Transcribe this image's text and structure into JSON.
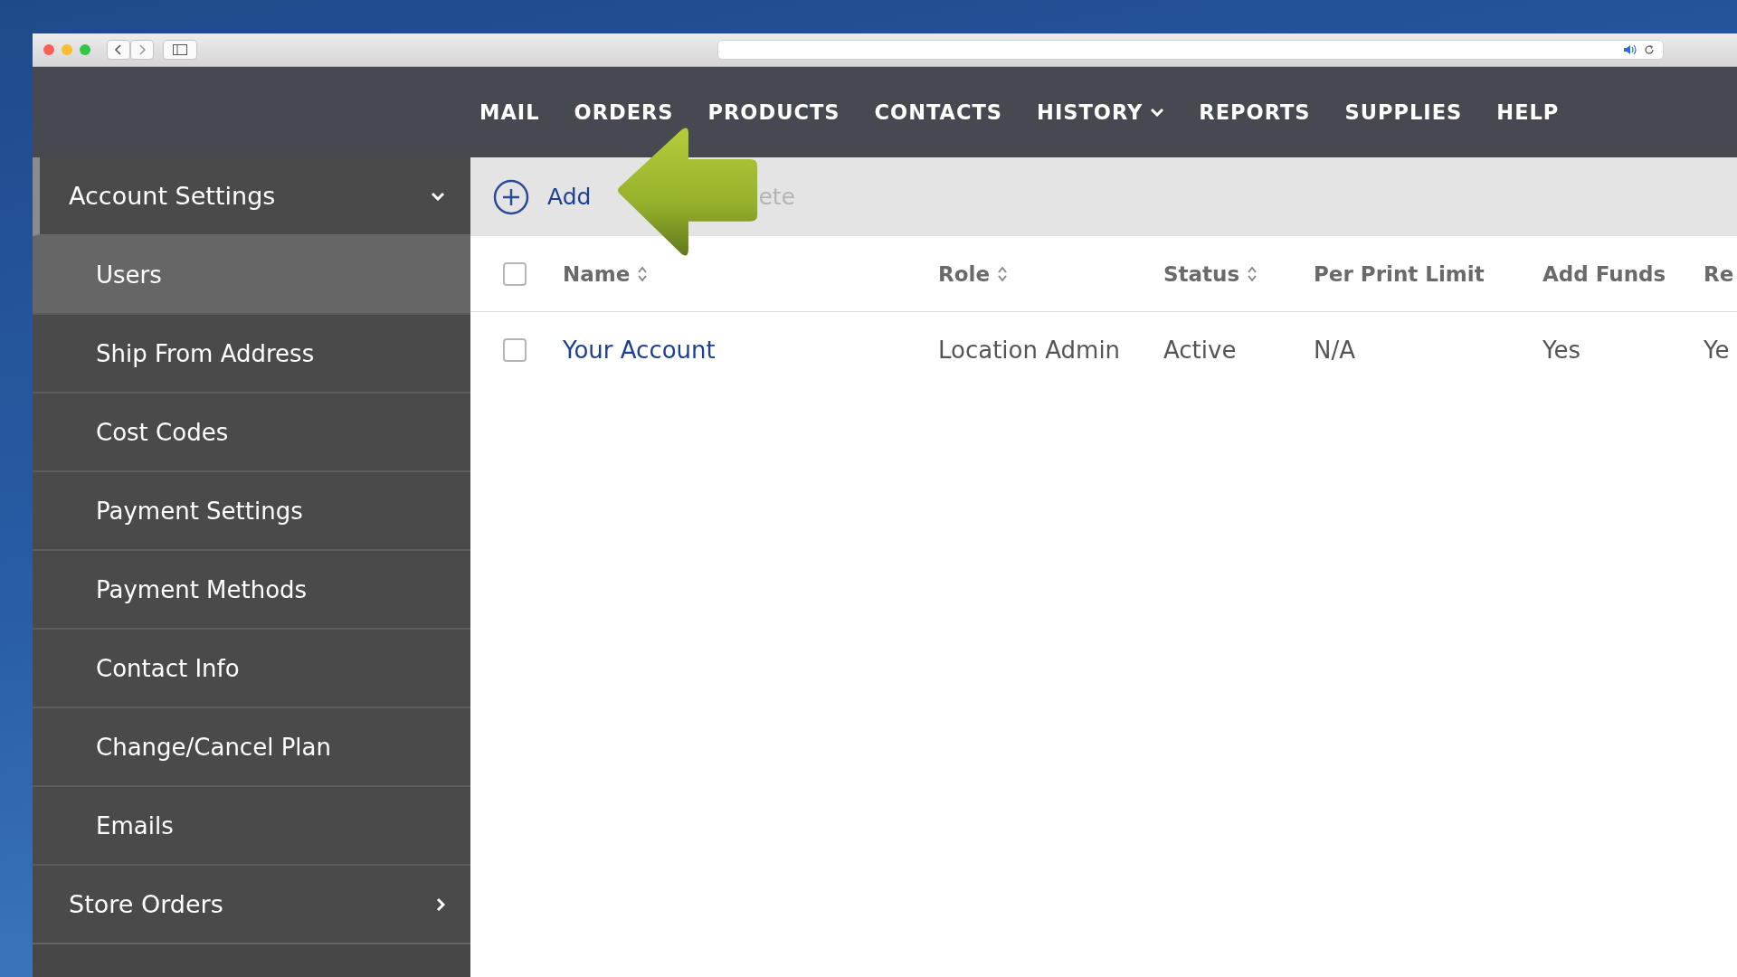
{
  "nav": [
    {
      "label": "MAIL",
      "has_menu": false
    },
    {
      "label": "ORDERS",
      "has_menu": false
    },
    {
      "label": "PRODUCTS",
      "has_menu": false
    },
    {
      "label": "CONTACTS",
      "has_menu": false
    },
    {
      "label": "HISTORY",
      "has_menu": true
    },
    {
      "label": "REPORTS",
      "has_menu": false
    },
    {
      "label": "SUPPLIES",
      "has_menu": false
    },
    {
      "label": "HELP",
      "has_menu": false
    }
  ],
  "sidebar": [
    {
      "label": "Account Settings",
      "expanded": true,
      "children": [
        {
          "label": "Users",
          "selected": true
        },
        {
          "label": "Ship From Address",
          "selected": false
        },
        {
          "label": "Cost Codes",
          "selected": false
        },
        {
          "label": "Payment Settings",
          "selected": false
        },
        {
          "label": "Payment Methods",
          "selected": false
        },
        {
          "label": "Contact Info",
          "selected": false
        },
        {
          "label": "Change/Cancel Plan",
          "selected": false
        },
        {
          "label": "Emails",
          "selected": false
        }
      ]
    },
    {
      "label": "Store Orders",
      "expanded": false
    }
  ],
  "toolbar": [
    {
      "label": "Add",
      "kind": "add",
      "disabled": false
    },
    {
      "label": "ete",
      "kind": "delete",
      "disabled": true
    }
  ],
  "table": {
    "select_all_checked": false,
    "columns": [
      {
        "label": "Name",
        "sortable": true
      },
      {
        "label": "Role",
        "sortable": true
      },
      {
        "label": "Status",
        "sortable": true
      },
      {
        "label": "Per Print Limit",
        "sortable": false
      },
      {
        "label": "Add Funds",
        "sortable": false
      },
      {
        "label": "Re",
        "sortable": false
      }
    ],
    "rows": [
      {
        "checked": false,
        "cells": [
          "Your Account",
          "Location Admin",
          "Active",
          "N/A",
          "Yes",
          "Ye"
        ]
      }
    ]
  }
}
